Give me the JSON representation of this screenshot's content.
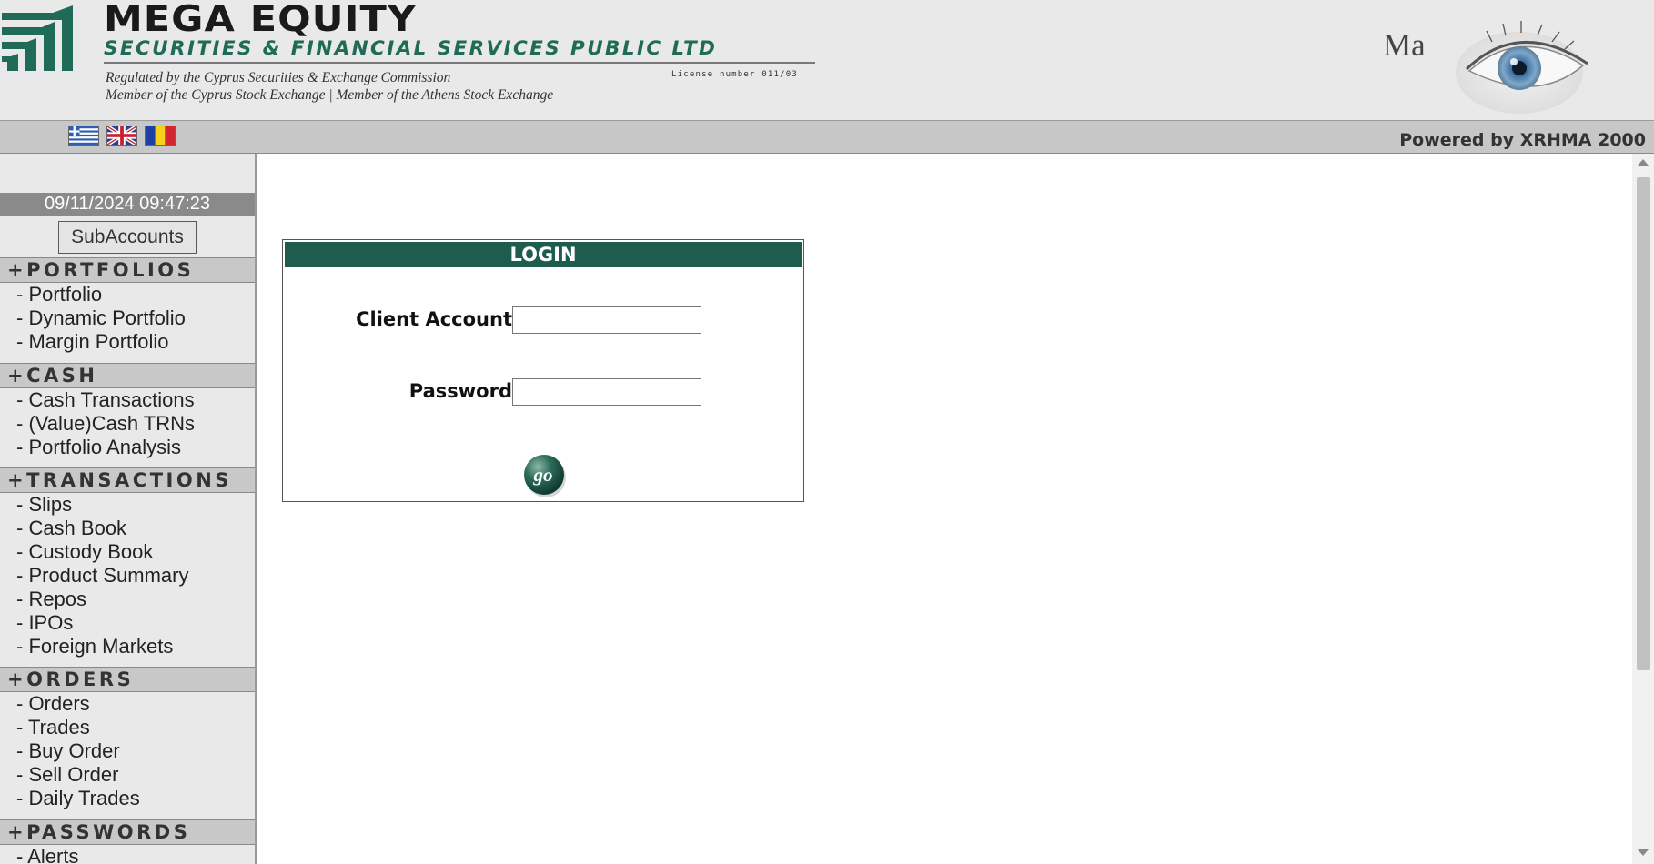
{
  "header": {
    "brand_name": "MEGA EQUITY",
    "brand_subtitle": "SECURITIES & FINANCIAL SERVICES PUBLIC LTD",
    "license": "License number 011/03",
    "regulation_line_1": "Regulated by the Cyprus Securities & Exchange Commission",
    "regulation_line_2": "Member of the Cyprus Stock Exchange  |  Member of the Athens Stock Exchange",
    "ma_text": "Ma",
    "logo_icon": "mega-equity-logo",
    "eye_icon": "eye-icon"
  },
  "lang_bar": {
    "flags": [
      "greek-flag",
      "uk-flag",
      "romanian-flag"
    ],
    "powered_by": "Powered by XRHMA 2000"
  },
  "sidebar": {
    "datetime": "09/11/2024 09:47:23",
    "subaccounts_label": "SubAccounts",
    "sections": [
      {
        "header": "+PORTFOLIOS",
        "items": [
          "- Portfolio",
          "- Dynamic Portfolio",
          "- Margin Portfolio"
        ]
      },
      {
        "header": "+CASH",
        "items": [
          "- Cash Transactions",
          "- (Value)Cash TRNs",
          "- Portfolio Analysis"
        ]
      },
      {
        "header": "+TRANSACTIONS",
        "items": [
          "- Slips",
          "- Cash Book",
          "- Custody Book",
          "- Product Summary",
          "- Repos",
          "- IPOs",
          "- Foreign Markets"
        ]
      },
      {
        "header": "+ORDERS",
        "items": [
          "- Orders",
          "- Trades",
          "- Buy Order",
          "- Sell Order",
          "- Daily Trades"
        ]
      },
      {
        "header": "+PASSWORDS",
        "items": [
          "- Alerts"
        ]
      }
    ]
  },
  "login": {
    "title": "LOGIN",
    "client_account_label": "Client Account",
    "client_account_value": "",
    "password_label": "Password",
    "password_value": "",
    "go_label": "go"
  },
  "colors": {
    "brand_green": "#1e5c4e",
    "subtitle_green": "#1f6b57",
    "header_bg": "#e9e9e9",
    "section_bg": "#c8c8c8",
    "datetime_bg": "#8a8a8a"
  }
}
